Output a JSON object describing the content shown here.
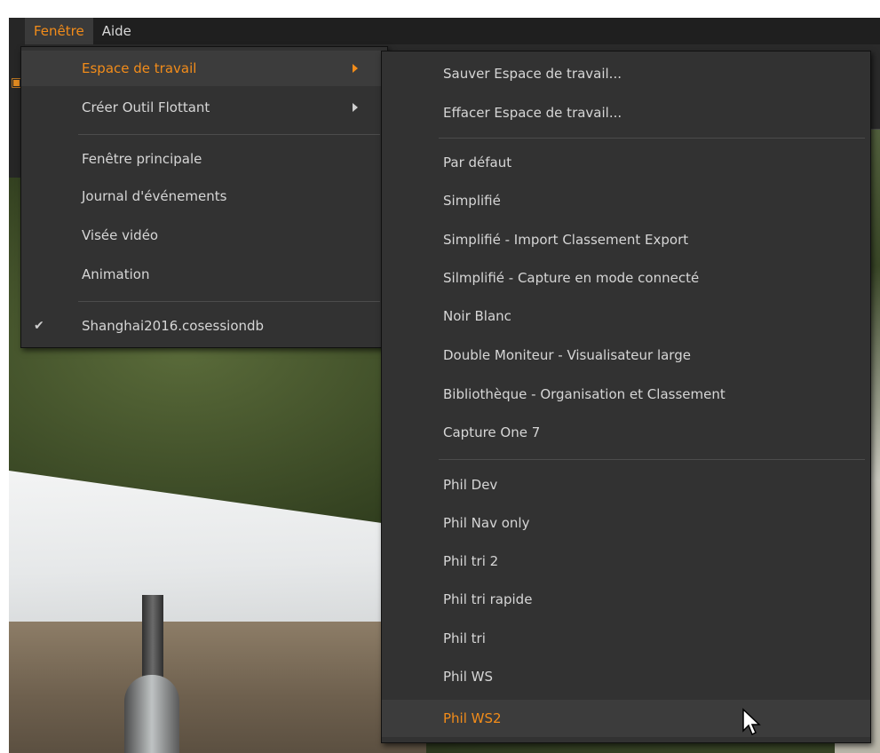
{
  "menubar": {
    "items": [
      "Fenêtre",
      "Aide"
    ]
  },
  "window_menu": {
    "items": [
      {
        "label": "Espace de travail",
        "submenu": true
      },
      {
        "label": "Créer Outil Flottant",
        "submenu": true
      },
      {
        "label": "Fenêtre principale"
      },
      {
        "label": "Journal d'événements"
      },
      {
        "label": "Visée vidéo"
      },
      {
        "label": "Animation"
      },
      {
        "label": "Shanghai2016.cosessiondb",
        "checked": true
      }
    ]
  },
  "workspace_menu": {
    "items": [
      "Sauver Espace de travail...",
      "Effacer Espace de travail...",
      "Par défaut",
      "Simplifié",
      "Simplifié - Import Classement Export",
      "Silmplifié - Capture en mode connecté",
      "Noir  Blanc",
      "Double Moniteur - Visualisateur large",
      "Bibliothèque - Organisation et Classement",
      "Capture One 7",
      "Phil Dev",
      "Phil Nav only",
      "Phil tri 2",
      "Phil tri rapide",
      "Phil tri",
      "Phil WS",
      "Phil WS2"
    ]
  },
  "icons": {
    "check": "checkmark-icon",
    "arrow": "submenu-arrow-icon",
    "cursor": "mouse-pointer-icon"
  },
  "colors": {
    "accent": "#f28c1a",
    "menu_bg": "#323232",
    "menubar_bg": "#1f1f1f",
    "text": "#d6d6d6"
  }
}
